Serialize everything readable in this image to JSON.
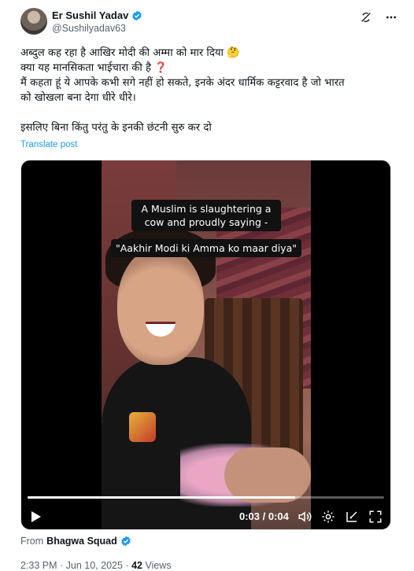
{
  "author": {
    "display_name": "Er Sushil Yadav",
    "handle": "@Sushilyadav63"
  },
  "tweet": {
    "lines": [
      "अब्दुल कह रहा है आखिर मोदी की अम्मा को मार दिया 🤔",
      "क्या यह मानसिकता भाईचारा की है ❓",
      "मैं कहता हूं ये आपके कभी सगे नहीं हो सकते, इनके अंदर धार्मिक कट्टरवाद है जो भारत",
      "को खोखला बना देगा धीरे धीरे।",
      "इसलिए बिना किंतु परंतु के इनकी छंटनी सुरु कर दो"
    ],
    "translate_label": "Translate post"
  },
  "video": {
    "caption_1": "A Muslim is slaughtering a cow and proudly saying -",
    "caption_2": "\"Aakhir Modi ki Amma ko maar diya\"",
    "time": "0:03 / 0:04",
    "progress": 0.75
  },
  "source": {
    "prefix": "From",
    "name": "Bhagwa Squad"
  },
  "meta": {
    "timestamp": "2:33 PM · Jun 10, 2025 · ",
    "views_count": "42",
    "views_label": "Views"
  },
  "colors": {
    "link": "#1d9bf0",
    "verified": "#1d9bf0",
    "muted": "#536471"
  },
  "icons": [
    "grok-icon",
    "more-icon",
    "verified-badge-icon",
    "play-icon",
    "volume-icon",
    "settings-icon",
    "pip-icon",
    "fullscreen-icon"
  ]
}
